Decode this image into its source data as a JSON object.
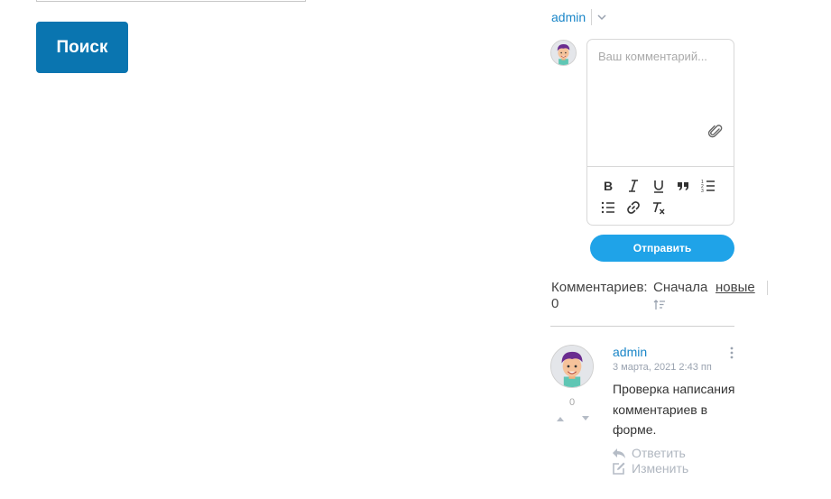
{
  "search": {
    "button_label": "Поиск"
  },
  "user": {
    "name": "admin"
  },
  "editor": {
    "placeholder": "Ваш комментарий...",
    "toolbar": [
      {
        "name": "bold"
      },
      {
        "name": "italic"
      },
      {
        "name": "underline"
      },
      {
        "name": "quote"
      },
      {
        "name": "ordered-list"
      },
      {
        "name": "bullet-list"
      },
      {
        "name": "link"
      },
      {
        "name": "clear-format"
      }
    ]
  },
  "submit": {
    "label": "Отправить"
  },
  "comments": {
    "count_label": "Комментариев:",
    "count": "0",
    "sort_prefix": "Сначала",
    "sort_value": "новые",
    "items": [
      {
        "author": "admin",
        "date": "3 марта, 2021 2:43 пп",
        "text": "Проверка написания комментариев в форме.",
        "votes": "0",
        "reply_label": "Ответить",
        "edit_label": "Изменить"
      }
    ]
  },
  "colors": {
    "primary_dark": "#0a75b0",
    "primary_light": "#1fa3e8",
    "link": "#1a86c8"
  }
}
